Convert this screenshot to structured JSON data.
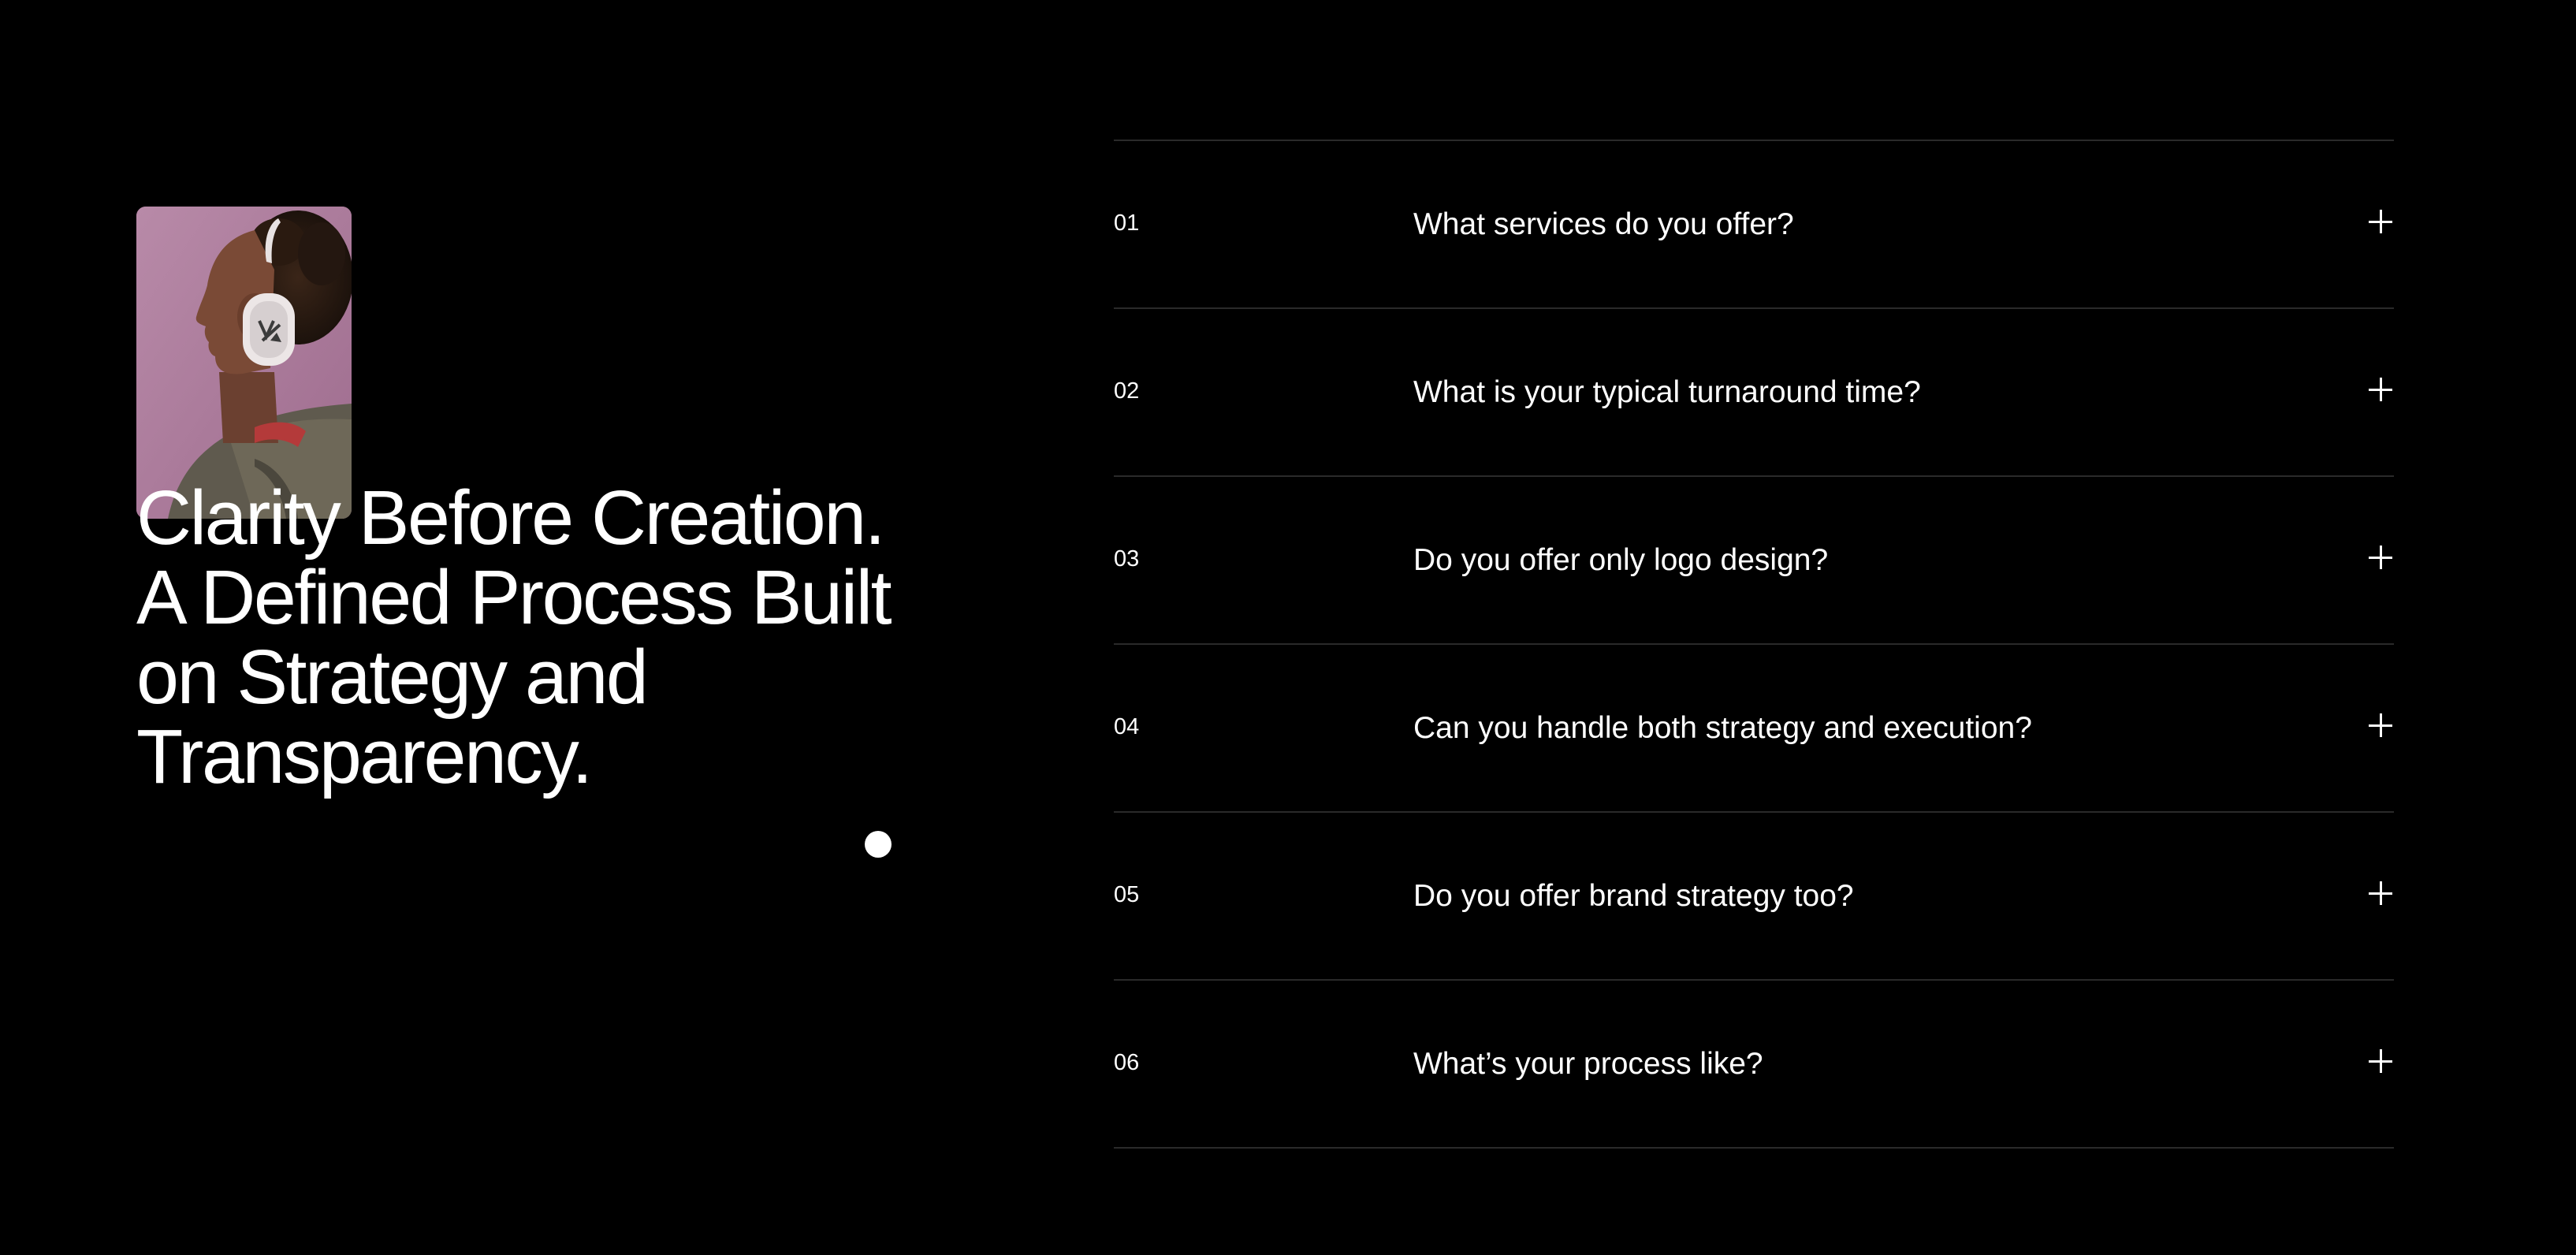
{
  "hero": {
    "image_icon": "portrait-headphones-photo",
    "headline_lines": [
      "Clarity Before Creation.",
      "A Defined Process Built",
      "on Strategy and",
      "Transparency."
    ]
  },
  "faq": {
    "toggle_icon": "plus-icon",
    "items": [
      {
        "number": "01",
        "question": "What services do you offer?"
      },
      {
        "number": "02",
        "question": "What is your typical turnaround time?"
      },
      {
        "number": "03",
        "question": "Do you offer only logo design?"
      },
      {
        "number": "04",
        "question": "Can you handle both strategy and execution?"
      },
      {
        "number": "05",
        "question": "Do you offer brand strategy too?"
      },
      {
        "number": "06",
        "question": "What’s your process like?"
      }
    ]
  },
  "colors": {
    "background": "#000000",
    "text": "#ffffff",
    "divider": "#2a2a2a",
    "photo_backdrop": "#b07a9c",
    "headline_overlap_accent": "#6f9a86"
  }
}
